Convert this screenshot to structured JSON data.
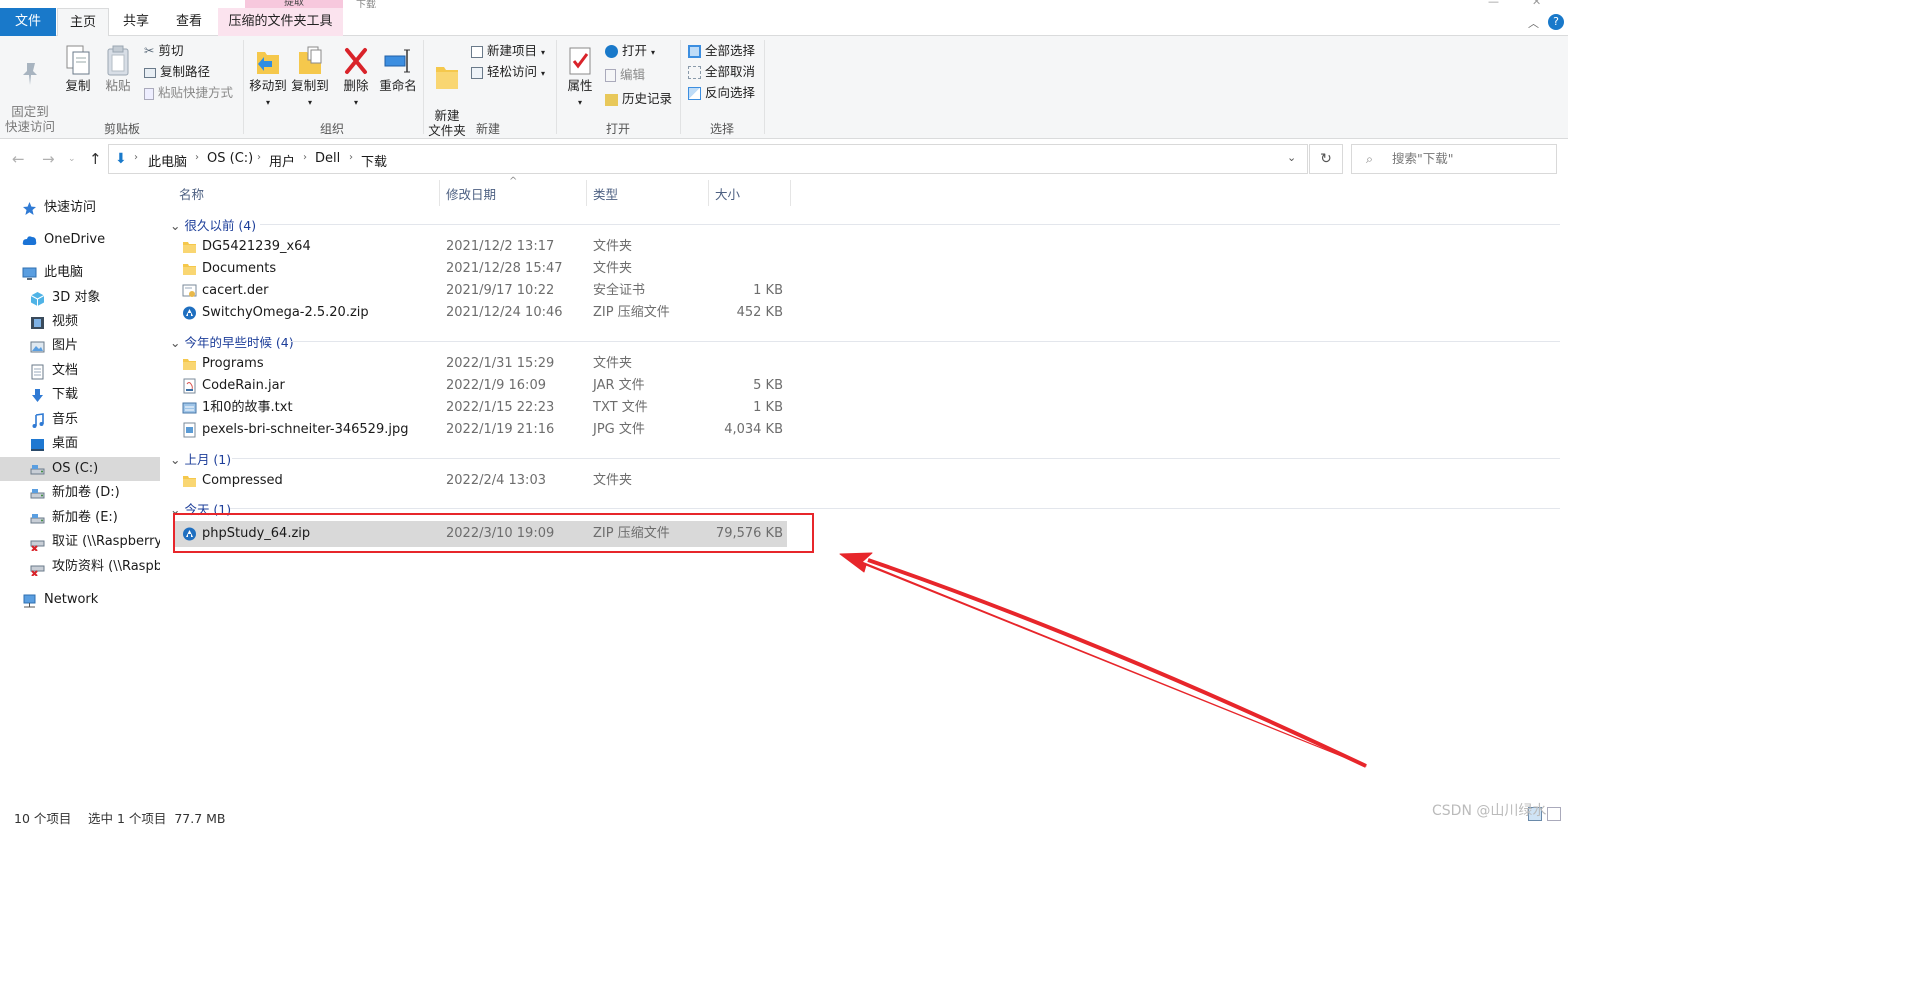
{
  "titlebar": {
    "context_group": "提取",
    "window_title": "下载"
  },
  "tabs": [
    {
      "label": "文件"
    },
    {
      "label": "主页"
    },
    {
      "label": "共享"
    },
    {
      "label": "查看"
    },
    {
      "label": "压缩的文件夹工具"
    }
  ],
  "ribbon": {
    "clipboard": {
      "title": "剪贴板",
      "pin": "固定到\n快速访问",
      "copy": "复制",
      "paste": "粘贴",
      "cut": "剪切",
      "copy_path": "复制路径",
      "paste_shortcut": "粘贴快捷方式"
    },
    "organize": {
      "title": "组织",
      "move_to": "移动到",
      "copy_to": "复制到",
      "delete": "删除",
      "rename": "重命名"
    },
    "new": {
      "title": "新建",
      "new_folder": "新建\n文件夹",
      "new_item": "新建项目",
      "easy_access": "轻松访问"
    },
    "open": {
      "title": "打开",
      "properties": "属性",
      "open": "打开",
      "edit": "编辑",
      "history": "历史记录"
    },
    "select": {
      "title": "选择",
      "select_all": "全部选择",
      "select_none": "全部取消",
      "invert": "反向选择"
    }
  },
  "address": {
    "crumbs": [
      "此电脑",
      "OS (C:)",
      "用户",
      "Dell",
      "下载"
    ],
    "search_placeholder": "搜索\"下载\""
  },
  "nav": [
    {
      "label": "快速访问",
      "icon": "star-icon"
    },
    {
      "label": "OneDrive",
      "icon": "cloud-icon"
    },
    {
      "label": "此电脑",
      "icon": "pc-icon"
    },
    {
      "label": "3D 对象",
      "icon": "cube-icon"
    },
    {
      "label": "视频",
      "icon": "film-icon"
    },
    {
      "label": "图片",
      "icon": "picture-icon"
    },
    {
      "label": "文档",
      "icon": "document-icon"
    },
    {
      "label": "下载",
      "icon": "download-icon"
    },
    {
      "label": "音乐",
      "icon": "music-icon"
    },
    {
      "label": "桌面",
      "icon": "desktop-icon"
    },
    {
      "label": "OS (C:)",
      "icon": "drive-icon"
    },
    {
      "label": "新加卷 (D:)",
      "icon": "drive-icon"
    },
    {
      "label": "新加卷 (E:)",
      "icon": "drive-icon"
    },
    {
      "label": "取证 (\\\\Raspberryp",
      "icon": "network-drive-icon"
    },
    {
      "label": "攻防资料 (\\\\Raspbe",
      "icon": "network-drive-icon"
    },
    {
      "label": "Network",
      "icon": "network-icon"
    }
  ],
  "columns": {
    "name": "名称",
    "date": "修改日期",
    "type": "类型",
    "size": "大小"
  },
  "groups": [
    {
      "label": "很久以前 (4)",
      "rows": [
        {
          "name": "DG5421239_x64",
          "date": "2021/12/2 13:17",
          "type": "文件夹",
          "size": "",
          "icon": "folder-icon"
        },
        {
          "name": "Documents",
          "date": "2021/12/28 15:47",
          "type": "文件夹",
          "size": "",
          "icon": "folder-icon"
        },
        {
          "name": "cacert.der",
          "date": "2021/9/17 10:22",
          "type": "安全证书",
          "size": "1 KB",
          "icon": "certificate-icon"
        },
        {
          "name": "SwitchyOmega-2.5.20.zip",
          "date": "2021/12/24 10:46",
          "type": "ZIP 压缩文件",
          "size": "452 KB",
          "icon": "zip-icon"
        }
      ]
    },
    {
      "label": "今年的早些时候 (4)",
      "rows": [
        {
          "name": "Programs",
          "date": "2022/1/31 15:29",
          "type": "文件夹",
          "size": "",
          "icon": "folder-icon"
        },
        {
          "name": "CodeRain.jar",
          "date": "2022/1/9 16:09",
          "type": "JAR 文件",
          "size": "5 KB",
          "icon": "jar-icon"
        },
        {
          "name": "1和0的故事.txt",
          "date": "2022/1/15 22:23",
          "type": "TXT 文件",
          "size": "1 KB",
          "icon": "text-file-icon"
        },
        {
          "name": "pexels-bri-schneiter-346529.jpg",
          "date": "2022/1/19 21:16",
          "type": "JPG 文件",
          "size": "4,034 KB",
          "icon": "image-file-icon"
        }
      ]
    },
    {
      "label": "上月 (1)",
      "rows": [
        {
          "name": "Compressed",
          "date": "2022/2/4 13:03",
          "type": "文件夹",
          "size": "",
          "icon": "folder-icon"
        }
      ]
    },
    {
      "label": "今天 (1)",
      "rows": [
        {
          "name": "phpStudy_64.zip",
          "date": "2022/3/10 19:09",
          "type": "ZIP 压缩文件",
          "size": "79,576 KB",
          "icon": "zip-icon"
        }
      ]
    }
  ],
  "status": {
    "count": "10 个项目",
    "selected": "选中 1 个项目  77.7 MB"
  },
  "watermark": "CSDN @山川绿水",
  "colors": {
    "accent": "#1979ca",
    "highlight": "#e7262b",
    "selection": "#d9d9d9"
  }
}
